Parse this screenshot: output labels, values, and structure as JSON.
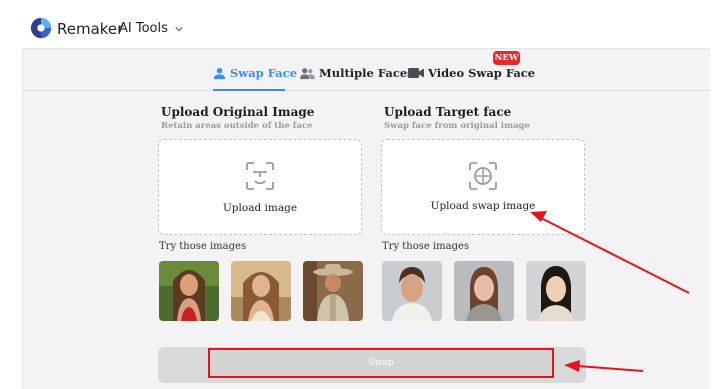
{
  "header": {
    "brand": "Remaker",
    "menu_label": "AI Tools"
  },
  "tabs": [
    {
      "label": "Swap Face",
      "active": true
    },
    {
      "label": "Multiple Faces",
      "active": false
    },
    {
      "label": "Video Swap Face",
      "active": false,
      "badge": "NEW"
    }
  ],
  "original": {
    "title": "Upload Original Image",
    "subtitle": "Retain areas outside of the face",
    "upload_label": "Upload image",
    "try_label": "Try those images"
  },
  "target": {
    "title": "Upload Target face",
    "subtitle": "Swap face from original image",
    "upload_label": "Upload swap image",
    "try_label": "Try those images"
  },
  "swap_button": {
    "label": "Swap"
  },
  "colors": {
    "accent": "#3b8ee8",
    "badge": "#e8282b",
    "annotation": "#e2141c"
  }
}
